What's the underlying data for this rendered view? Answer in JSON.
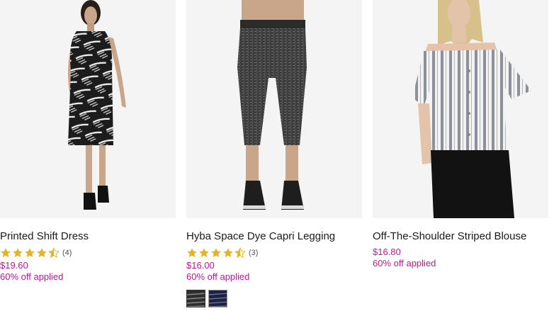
{
  "colors": {
    "price": "#c4178a",
    "star": "#e8b321",
    "star_empty": "#d8d8d8"
  },
  "products": [
    {
      "name": "Printed Shift Dress",
      "rating": 4.5,
      "review_count": "(4)",
      "price": "$19.60",
      "discount": "60% off applied",
      "image_icon": "dress-photo"
    },
    {
      "name": "Hyba Space Dye Capri Legging",
      "rating": 4.5,
      "review_count": "(3)",
      "price": "$16.00",
      "discount": "60% off applied",
      "image_icon": "legging-photo",
      "swatches": [
        "space-dye-black",
        "space-dye-navy"
      ]
    },
    {
      "name": "Off-The-Shoulder Striped Blouse",
      "price": "$16.80",
      "discount": "60% off applied",
      "image_icon": "blouse-photo"
    }
  ]
}
